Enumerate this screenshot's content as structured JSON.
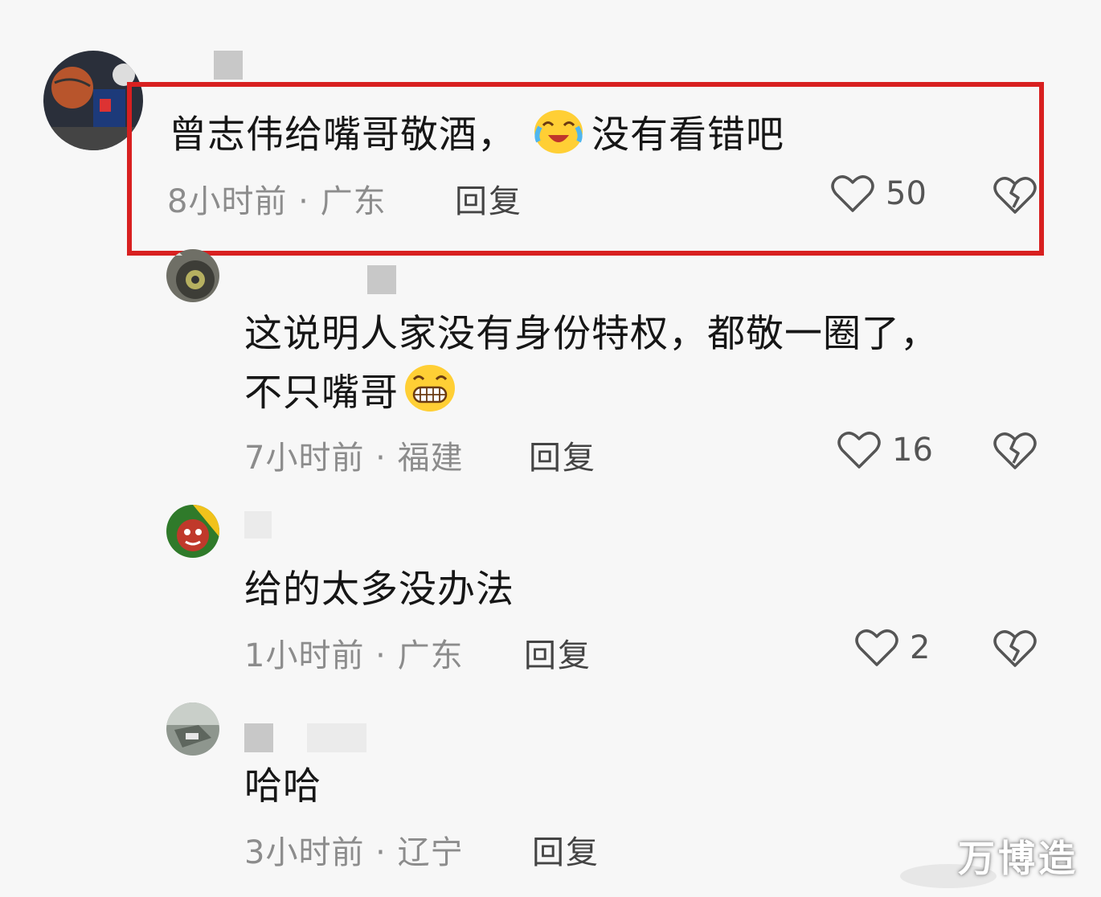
{
  "comments": [
    {
      "text": "曾志伟给嘴哥敬酒，",
      "text_after": "没有看错吧",
      "emoji": "crying-laugh-emoji",
      "time": "8小时前",
      "sep": "·",
      "location": "广东",
      "reply_label": "回复",
      "likes": "50"
    },
    {
      "text": "这说明人家没有身份特权，都敬一圈了，",
      "text_line2": "不只嘴哥",
      "emoji": "grin-emoji",
      "time": "7小时前",
      "sep": "·",
      "location": "福建",
      "reply_label": "回复",
      "likes": "16"
    },
    {
      "text": "给的太多没办法",
      "time": "1小时前",
      "sep": "·",
      "location": "广东",
      "reply_label": "回复",
      "likes": "2"
    },
    {
      "text": "哈哈",
      "time": "3小时前",
      "sep": "·",
      "location": "辽宁",
      "reply_label": "回复"
    }
  ],
  "watermark": "万博造",
  "colors": {
    "highlight": "#d82020",
    "background": "#f7f7f7"
  },
  "icons": {
    "like": "heart-outline-icon",
    "dislike": "broken-heart-icon"
  }
}
